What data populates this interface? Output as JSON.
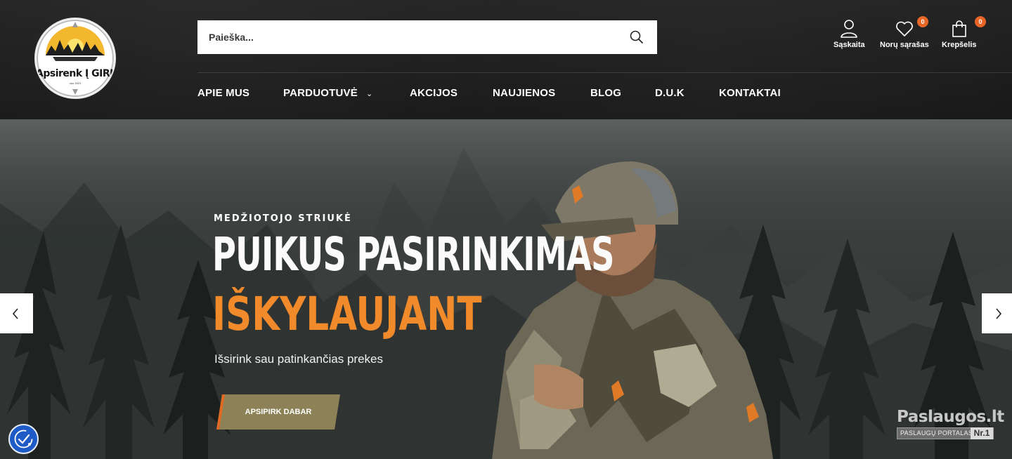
{
  "logo": {
    "text": "Apsirenk Į GIRIĄ",
    "sub": "nuo 2021"
  },
  "search": {
    "placeholder": "Paieška..."
  },
  "header_icons": {
    "account": {
      "label": "Sąskaita"
    },
    "wishlist": {
      "label": "Norų sąrašas",
      "count": "0"
    },
    "cart": {
      "label": "Krepšelis",
      "count": "0"
    }
  },
  "nav": {
    "items": [
      {
        "label": "APIE MUS"
      },
      {
        "label": "PARDUOTUVĖ"
      },
      {
        "label": "AKCIJOS"
      },
      {
        "label": "NAUJIENOS"
      },
      {
        "label": "BLOG"
      },
      {
        "label": "D.U.K"
      },
      {
        "label": "KONTAKTAI"
      }
    ]
  },
  "hero": {
    "eyebrow": "MEDŽIOTOJO STRIUKĖ",
    "headline_line1": "PUIKUS PASIRINKIMAS",
    "headline_line2": "IŠKYLAUJANT",
    "subtitle": "Išsirink sau patinkančias prekes",
    "cta_label": "APSIPIRK DABAR"
  },
  "watermark": {
    "title": "Paslaugos.lt",
    "subtitle": "PASLAUGŲ PORTALAS",
    "rank": "Nr.1"
  },
  "colors": {
    "accent": "#f08a2a",
    "badge": "#e86524",
    "cta": "#8d8157",
    "header_bg": "#1e1e1e",
    "access_button": "#1e5bc6"
  },
  "icons": [
    "search-icon",
    "user-icon",
    "heart-icon",
    "shopping-bag-icon",
    "chevron-down-icon",
    "chevron-left-icon",
    "chevron-right-icon",
    "accessibility-icon"
  ]
}
